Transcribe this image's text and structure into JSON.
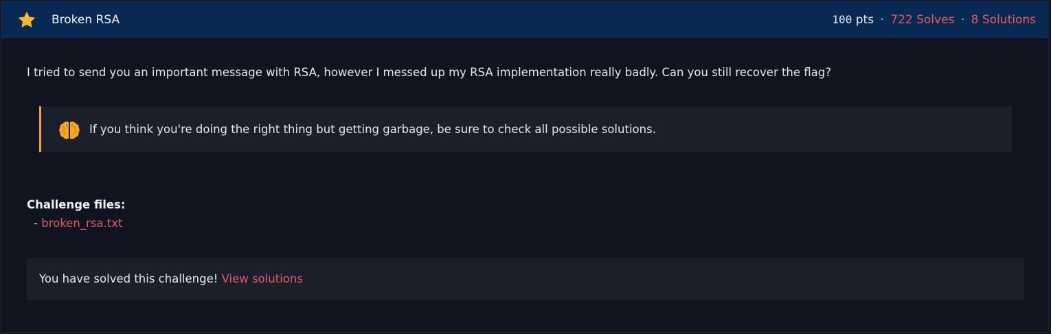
{
  "challenge": {
    "title": "Broken RSA",
    "points_value": "100",
    "points_unit": "pts",
    "separator": "·",
    "solves": "722 Solves",
    "solutions": "8 Solutions",
    "star_icon": "star-icon",
    "star_color": "#f5b82e"
  },
  "description": "I tried to send you an important message with RSA, however I messed up my RSA implementation really badly. Can you still recover the flag?",
  "hint": {
    "icon": "brain-icon",
    "accent_color": "#f5a623",
    "text": "If you think you're doing the right thing but getting garbage, be sure to check all possible solutions."
  },
  "files": {
    "label": "Challenge files:",
    "bullet": "-",
    "items": [
      {
        "name": "broken_rsa.txt"
      }
    ]
  },
  "solved_banner": {
    "text": "You have solved this challenge!",
    "link": "View solutions"
  },
  "colors": {
    "header_bg": "#082a52",
    "page_bg": "#0f1420",
    "panel_bg": "#1a1f2b",
    "link": "#e25c62"
  }
}
